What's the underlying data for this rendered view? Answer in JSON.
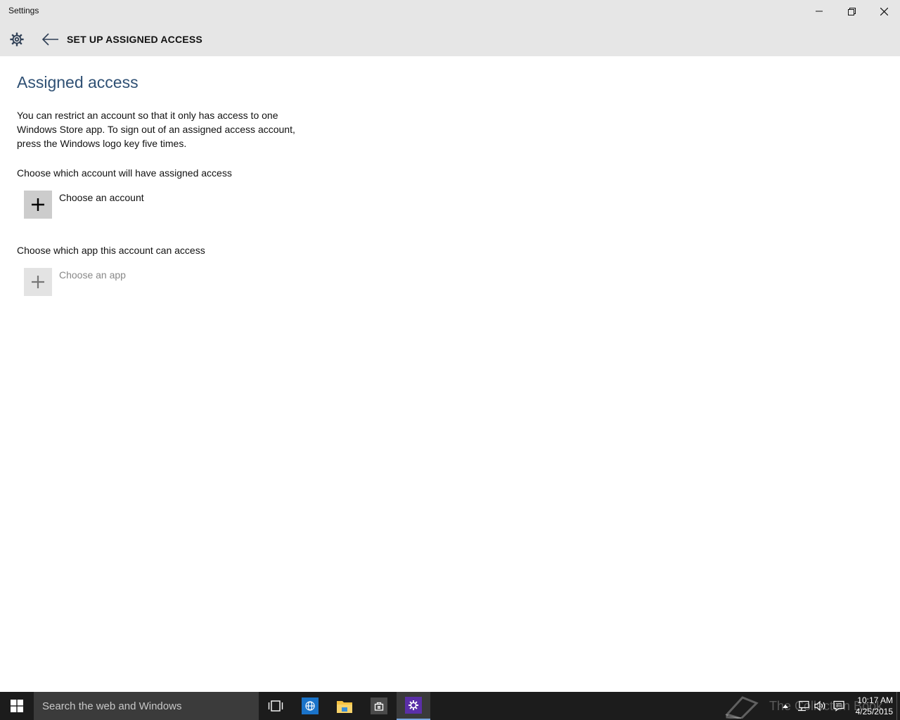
{
  "window": {
    "title": "Settings"
  },
  "nav": {
    "page_title": "SET UP ASSIGNED ACCESS"
  },
  "main": {
    "heading": "Assigned access",
    "description": "You can restrict an account so that it only has access to one Windows Store app. To sign out of an assigned access account, press the Windows logo key five times.",
    "account_section_label": "Choose which account will have assigned access",
    "account_button_label": "Choose an account",
    "app_section_label": "Choose which app this account can access",
    "app_button_label": "Choose an app"
  },
  "taskbar": {
    "search_placeholder": "Search the web and Windows",
    "watermark_text": "The Collection Book",
    "time": "10:17 AM",
    "date": "4/25/2015"
  },
  "colors": {
    "heading": "#2f5074",
    "chrome": "#e6e6e6",
    "taskbar": "#1c1c1c",
    "settings_tile": "#5b2fa8"
  }
}
